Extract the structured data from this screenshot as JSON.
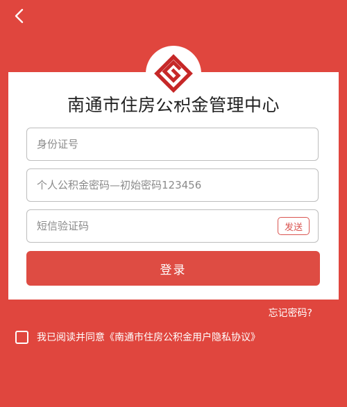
{
  "header": {
    "back_icon": "chevron-left-icon"
  },
  "logo": {
    "icon": "housing-fund-logo-icon",
    "color": "#c62828"
  },
  "login": {
    "title": "南通市住房公积金管理中心",
    "id_placeholder": "身份证号",
    "password_placeholder": "个人公积金密码—初始密码123456",
    "sms_placeholder": "短信验证码",
    "send_label": "发送",
    "login_label": "登录"
  },
  "forgot_label": "忘记密码?",
  "agreement": {
    "text": "我已阅读并同意《南通市住房公积金用户隐私协议》"
  },
  "colors": {
    "background": "#e0463e",
    "button": "#de4c43",
    "card": "#ffffff"
  }
}
